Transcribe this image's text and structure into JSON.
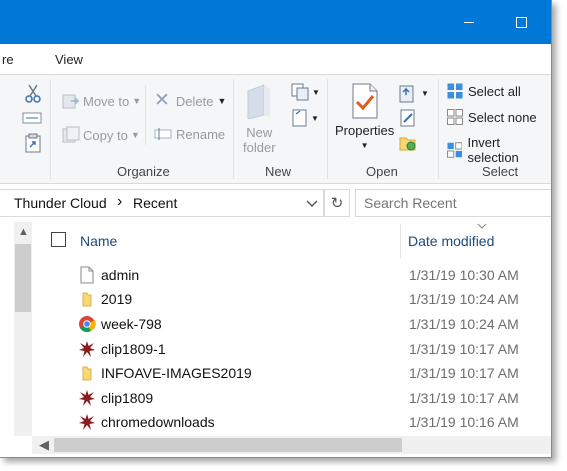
{
  "window": {
    "tabs": [
      "re",
      "View"
    ]
  },
  "ribbon": {
    "organize": {
      "move_to": "Move to",
      "copy_to": "Copy to",
      "delete": "Delete",
      "rename": "Rename",
      "label": "Organize"
    },
    "new": {
      "new_folder_line1": "New",
      "new_folder_line2": "folder",
      "label": "New"
    },
    "open": {
      "properties": "Properties",
      "label": "Open"
    },
    "select": {
      "select_all": "Select all",
      "select_none": "Select none",
      "invert_selection": "Invert selection",
      "label": "Select"
    }
  },
  "address": {
    "breadcrumb": [
      "Thunder Cloud",
      "Recent"
    ],
    "separator": "›",
    "search_placeholder": "Search Recent"
  },
  "list": {
    "columns": {
      "name": "Name",
      "date_modified": "Date modified"
    },
    "files": [
      {
        "name": "admin",
        "date": "1/31/19 10:30 AM",
        "icon": "document-icon"
      },
      {
        "name": "2019",
        "date": "1/31/19 10:24 AM",
        "icon": "folder-icon"
      },
      {
        "name": "week-798",
        "date": "1/31/19 10:24 AM",
        "icon": "chrome-icon"
      },
      {
        "name": "clip1809-1",
        "date": "1/31/19 10:17 AM",
        "icon": "splat-icon"
      },
      {
        "name": "INFOAVE-IMAGES2019",
        "date": "1/31/19 10:17 AM",
        "icon": "folder-icon"
      },
      {
        "name": "clip1809",
        "date": "1/31/19 10:17 AM",
        "icon": "splat-icon"
      },
      {
        "name": "chromedownloads",
        "date": "1/31/19 10:16 AM",
        "icon": "splat-icon"
      }
    ]
  },
  "colors": {
    "titlebar": "#0078d7",
    "header_text": "#1c4a7c",
    "folder": "#f8d775",
    "splat": "#8b1a1a"
  }
}
